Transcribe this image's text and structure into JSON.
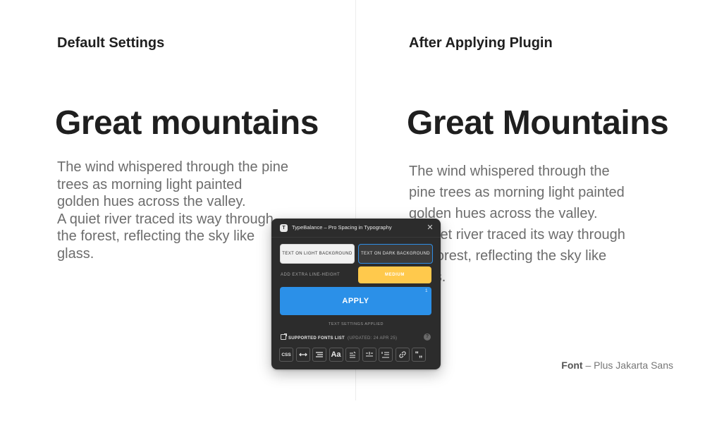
{
  "left": {
    "title": "Default Settings",
    "heading": "Great mountains",
    "lines": [
      "The wind whispered through the pine",
      "trees as morning light painted",
      "golden hues across the valley.",
      "A quiet river traced its way through",
      "the forest, reflecting the sky like",
      "glass."
    ]
  },
  "right": {
    "title": "After Applying Plugin",
    "heading": "Great Mountains",
    "lines": [
      "The wind whispered through the",
      "pine trees as morning light painted",
      "golden hues across the valley.",
      "A quiet river traced its way through",
      "the forest, reflecting the sky like",
      "glass."
    ]
  },
  "font_credit": {
    "label": "Font",
    "value": " – Plus Jakarta Sans"
  },
  "plugin": {
    "logo": "T",
    "title": "TypeBalance – Pro Spacing in Typography",
    "close": "✕",
    "bg_light": "TEXT ON LIGHT BACKGROUND",
    "bg_dark": "TEXT ON DARK BACKGROUND",
    "line_height_label": "ADD EXTRA LINE-HEIGHT",
    "line_height_value": "MEDIUM",
    "apply": "APPLY",
    "apply_count": "1",
    "status": "TEXT SETTINGS APPLIED",
    "fonts_label": "SUPPORTED FONTS LIST",
    "fonts_updated": "(UPDATED: 24 APR 25)",
    "help": "?",
    "tools": {
      "css": "CSS",
      "case": "Aa",
      "quotes": "\"„"
    },
    "colors": {
      "accent": "#2b90e8",
      "medium": "#ffc94c",
      "bg": "#2c2c2c"
    }
  }
}
